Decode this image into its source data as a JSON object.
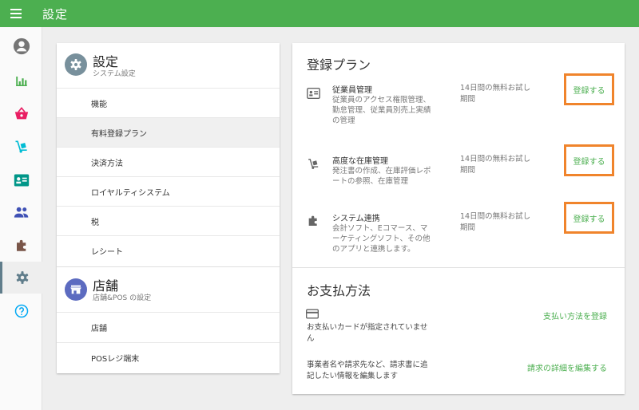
{
  "app": {
    "title": "設定"
  },
  "rail": {
    "items": [
      {
        "icon": "account-icon",
        "color": "#757575"
      },
      {
        "icon": "bar-chart-icon",
        "color": "#4caf50"
      },
      {
        "icon": "basket-icon",
        "color": "#e91e63"
      },
      {
        "icon": "hand-truck-icon",
        "color": "#00bcd4"
      },
      {
        "icon": "badge-icon",
        "color": "#009688"
      },
      {
        "icon": "people-icon",
        "color": "#3f51b5"
      },
      {
        "icon": "puzzle-icon",
        "color": "#795548"
      },
      {
        "icon": "gear-icon",
        "color": "#607d8b"
      },
      {
        "icon": "help-icon",
        "color": "#03a9f4"
      }
    ]
  },
  "settings_section": {
    "title": "設定",
    "subtitle": "システム設定",
    "items": [
      "機能",
      "有料登録プラン",
      "決済方法",
      "ロイヤルティシステム",
      "税",
      "レシート"
    ]
  },
  "store_section": {
    "title": "店舗",
    "subtitle": "店舗&POS の設定",
    "items": [
      "店舗",
      "POSレジ端末"
    ]
  },
  "plans": {
    "title": "登録プラン",
    "items": [
      {
        "name": "従業員管理",
        "desc": [
          "従業員のアクセス権限管理、",
          "勤怠管理、従業員別売上実績",
          "の管理"
        ],
        "trial": [
          "14日間の無料お試し",
          "期間"
        ],
        "button": "登録する"
      },
      {
        "name": "高度な在庫管理",
        "desc": [
          "発注書の作成、在庫評価レポ",
          "ートの参照、在庫管理"
        ],
        "trial": [
          "14日間の無料お試し",
          "期間"
        ],
        "button": "登録する"
      },
      {
        "name": "システム連携",
        "desc": [
          "会計ソフト、Eコマース、マ",
          "ーケティングソフト、その他",
          "のアプリと連携します。"
        ],
        "trial": [
          "14日間の無料お試し",
          "期間"
        ],
        "button": "登録する"
      }
    ]
  },
  "payment": {
    "title": "お支払方法",
    "card_text": [
      "お支払いカードが指定されていませ",
      "ん"
    ],
    "card_link": "支払い方法を登録",
    "billing_text": [
      "事業者名や請求先など、請求書に追",
      "記したい情報を編集します"
    ],
    "billing_link": "請求の詳細を編集する"
  },
  "colors": {
    "primary": "#4caf50",
    "highlight": "#f0842c"
  }
}
